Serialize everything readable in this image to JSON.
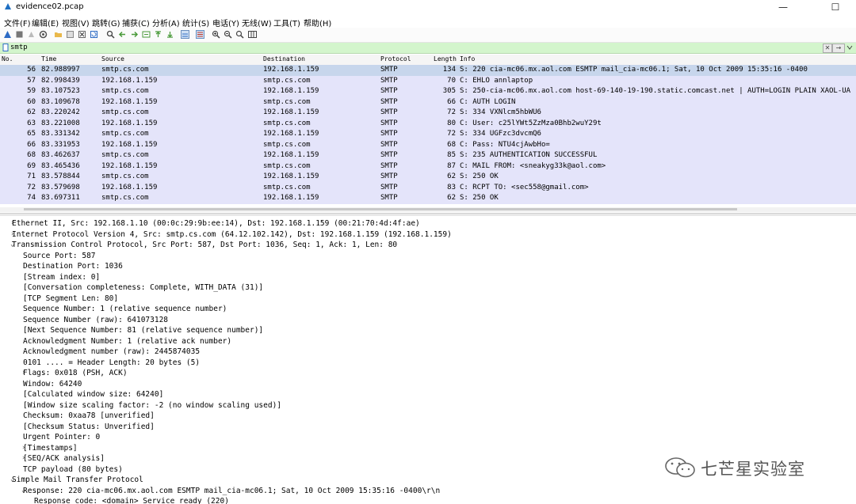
{
  "window": {
    "title": "evidence02.pcap",
    "controls": [
      "—",
      "☐",
      "✕"
    ]
  },
  "menu": [
    "文件(F)",
    "编辑(E)",
    "视图(V)",
    "跳转(G)",
    "捕获(C)",
    "分析(A)",
    "统计(S)",
    "电话(Y)",
    "无线(W)",
    "工具(T)",
    "帮助(H)"
  ],
  "filter": {
    "value": "smtp",
    "clear_label": "✕",
    "apply_label": "→"
  },
  "columns": [
    "No.",
    "Time",
    "Source",
    "Destination",
    "Protocol",
    "Length",
    "Info"
  ],
  "packets": [
    {
      "no": "56",
      "time": "82.988997",
      "src": "smtp.cs.com",
      "dst": "192.168.1.159",
      "proto": "SMTP",
      "len": "134",
      "info": "S: 220 cia-mc06.mx.aol.com ESMTP mail_cia-mc06.1; Sat, 10 Oct 2009 15:35:16 -0400"
    },
    {
      "no": "57",
      "time": "82.998439",
      "src": "192.168.1.159",
      "dst": "smtp.cs.com",
      "proto": "SMTP",
      "len": "70",
      "info": "C: EHLO annlaptop"
    },
    {
      "no": "59",
      "time": "83.107523",
      "src": "smtp.cs.com",
      "dst": "192.168.1.159",
      "proto": "SMTP",
      "len": "305",
      "info": "S: 250-cia-mc06.mx.aol.com host-69-140-19-190.static.comcast.net | AUTH=LOGIN PLAIN XAOL-UA"
    },
    {
      "no": "60",
      "time": "83.109678",
      "src": "192.168.1.159",
      "dst": "smtp.cs.com",
      "proto": "SMTP",
      "len": "66",
      "info": "C: AUTH LOGIN"
    },
    {
      "no": "62",
      "time": "83.220242",
      "src": "smtp.cs.com",
      "dst": "192.168.1.159",
      "proto": "SMTP",
      "len": "72",
      "info": "S: 334 VXNlcm5hbWU6"
    },
    {
      "no": "63",
      "time": "83.221008",
      "src": "192.168.1.159",
      "dst": "smtp.cs.com",
      "proto": "SMTP",
      "len": "80",
      "info": "C: User: c25lYWt5ZzMza0Bhb2wuY29t"
    },
    {
      "no": "65",
      "time": "83.331342",
      "src": "smtp.cs.com",
      "dst": "192.168.1.159",
      "proto": "SMTP",
      "len": "72",
      "info": "S: 334 UGFzc3dvcmQ6"
    },
    {
      "no": "66",
      "time": "83.331953",
      "src": "192.168.1.159",
      "dst": "smtp.cs.com",
      "proto": "SMTP",
      "len": "68",
      "info": "C: Pass: NTU4cjAwbHo="
    },
    {
      "no": "68",
      "time": "83.462637",
      "src": "smtp.cs.com",
      "dst": "192.168.1.159",
      "proto": "SMTP",
      "len": "85",
      "info": "S: 235 AUTHENTICATION SUCCESSFUL"
    },
    {
      "no": "69",
      "time": "83.465436",
      "src": "192.168.1.159",
      "dst": "smtp.cs.com",
      "proto": "SMTP",
      "len": "87",
      "info": "C: MAIL FROM: <sneakyg33k@aol.com>"
    },
    {
      "no": "71",
      "time": "83.578844",
      "src": "smtp.cs.com",
      "dst": "192.168.1.159",
      "proto": "SMTP",
      "len": "62",
      "info": "S: 250 OK"
    },
    {
      "no": "72",
      "time": "83.579698",
      "src": "192.168.1.159",
      "dst": "smtp.cs.com",
      "proto": "SMTP",
      "len": "83",
      "info": "C: RCPT TO: <sec558@gmail.com>"
    },
    {
      "no": "74",
      "time": "83.697311",
      "src": "smtp.cs.com",
      "dst": "192.168.1.159",
      "proto": "SMTP",
      "len": "62",
      "info": "S: 250 OK"
    }
  ],
  "details": [
    {
      "arrow": "›",
      "text": "Ethernet II, Src: 192.168.1.10 (00:0c:29:9b:ee:14), Dst: 192.168.1.159 (00:21:70:4d:4f:ae)"
    },
    {
      "arrow": "›",
      "text": "Internet Protocol Version 4, Src: smtp.cs.com (64.12.102.142), Dst: 192.168.1.159 (192.168.1.159)"
    },
    {
      "arrow": "⌄",
      "text": "Transmission Control Protocol, Src Port: 587, Dst Port: 1036, Seq: 1, Ack: 1, Len: 80"
    },
    {
      "arrow": "",
      "text": "Source Port: 587"
    },
    {
      "arrow": "",
      "text": "Destination Port: 1036"
    },
    {
      "arrow": "",
      "text": "[Stream index: 0]"
    },
    {
      "arrow": "",
      "text": "[Conversation completeness: Complete, WITH_DATA (31)]"
    },
    {
      "arrow": "",
      "text": "[TCP Segment Len: 80]"
    },
    {
      "arrow": "",
      "text": "Sequence Number: 1    (relative sequence number)"
    },
    {
      "arrow": "",
      "text": "Sequence Number (raw): 641073128"
    },
    {
      "arrow": "",
      "text": "[Next Sequence Number: 81    (relative sequence number)]"
    },
    {
      "arrow": "",
      "text": "Acknowledgment Number: 1    (relative ack number)"
    },
    {
      "arrow": "",
      "text": "Acknowledgment number (raw): 2445874035"
    },
    {
      "arrow": "",
      "text": "0101 .... = Header Length: 20 bytes (5)"
    },
    {
      "arrow": "›",
      "text": "Flags: 0x018 (PSH, ACK)"
    },
    {
      "arrow": "",
      "text": "Window: 64240"
    },
    {
      "arrow": "",
      "text": "[Calculated window size: 64240]"
    },
    {
      "arrow": "",
      "text": "[Window size scaling factor: -2 (no window scaling used)]"
    },
    {
      "arrow": "",
      "text": "Checksum: 0xaa78 [unverified]"
    },
    {
      "arrow": "",
      "text": "[Checksum Status: Unverified]"
    },
    {
      "arrow": "",
      "text": "Urgent Pointer: 0"
    },
    {
      "arrow": "›",
      "text": "[Timestamps]"
    },
    {
      "arrow": "›",
      "text": "[SEQ/ACK analysis]"
    },
    {
      "arrow": "",
      "text": "TCP payload (80 bytes)"
    },
    {
      "arrow": "⌄",
      "text": "Simple Mail Transfer Protocol"
    },
    {
      "arrow": "⌄",
      "text": "Response: 220 cia-mc06.mx.aol.com ESMTP mail_cia-mc06.1; Sat, 10 Oct 2009 15:35:16 -0400\\r\\n"
    },
    {
      "arrow": "",
      "text": "Response code: <domain> Service ready (220)"
    }
  ],
  "watermark": {
    "text": "七芒星实验室",
    "icon": "wechat-icon"
  },
  "colors": {
    "filter_bg": "#d3f5cc",
    "row_bg": "#e4e4fa",
    "row_selected": "#c7d6ec"
  }
}
